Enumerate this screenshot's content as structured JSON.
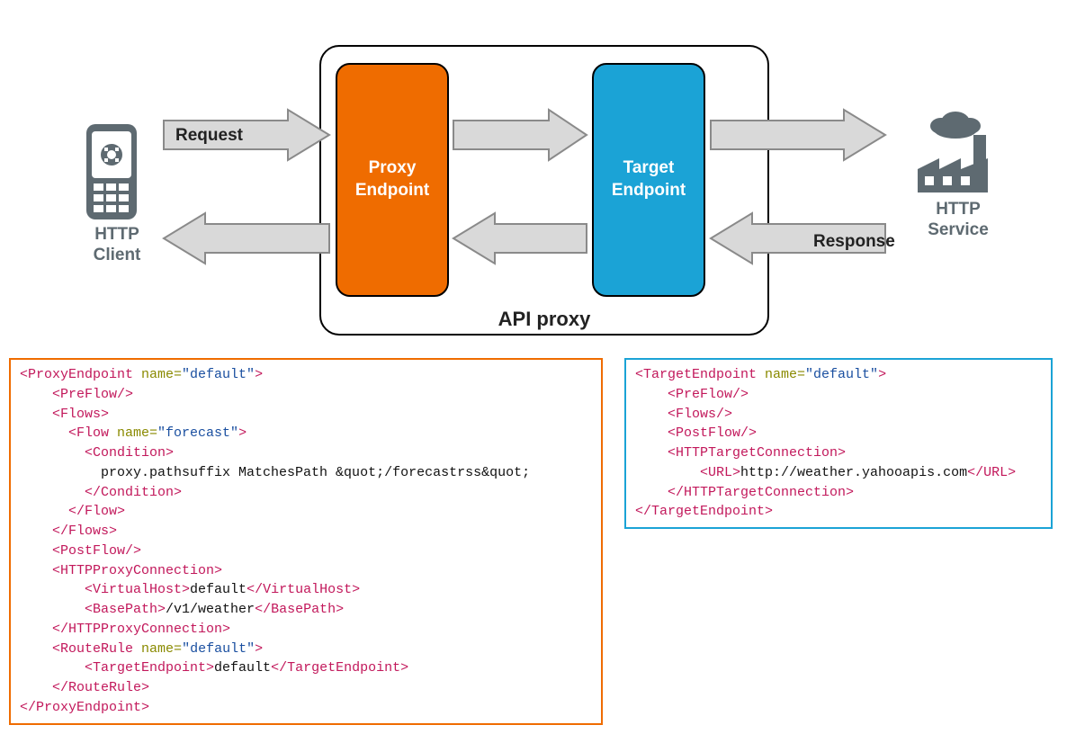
{
  "diagram": {
    "client_label_l1": "HTTP",
    "client_label_l2": "Client",
    "service_label_l1": "HTTP",
    "service_label_l2": "Service",
    "proxy_endpoint_l1": "Proxy",
    "proxy_endpoint_l2": "Endpoint",
    "target_endpoint_l1": "Target",
    "target_endpoint_l2": "Endpoint",
    "api_proxy_label": "API proxy",
    "request_label": "Request",
    "response_label": "Response"
  },
  "proxy_xml": {
    "root_open": "<ProxyEndpoint ",
    "root_attr": "name=",
    "root_val": "\"default\"",
    "root_close": ">",
    "preflow": "<PreFlow/>",
    "flows_open": "<Flows>",
    "flow_open": "<Flow ",
    "flow_attr": "name=",
    "flow_val": "\"forecast\"",
    "flow_close": ">",
    "cond_open": "<Condition>",
    "cond_text": "proxy.pathsuffix MatchesPath &quot;/forecastrss&quot;",
    "cond_close": "</Condition>",
    "flow_end": "</Flow>",
    "flows_close": "</Flows>",
    "postflow": "<PostFlow/>",
    "hpc_open": "<HTTPProxyConnection>",
    "vh_open": "<VirtualHost>",
    "vh_text": "default",
    "vh_close": "</VirtualHost>",
    "bp_open": "<BasePath>",
    "bp_text": "/v1/weather",
    "bp_close": "</BasePath>",
    "hpc_close": "</HTTPProxyConnection>",
    "rr_open": "<RouteRule ",
    "rr_attr": "name=",
    "rr_val": "\"default\"",
    "rr_close": ">",
    "te_open": "<TargetEndpoint>",
    "te_text": "default",
    "te_close": "</TargetEndpoint>",
    "rr_end": "</RouteRule>",
    "root_end": "</ProxyEndpoint>"
  },
  "target_xml": {
    "root_open": "<TargetEndpoint ",
    "root_attr": "name=",
    "root_val": "\"default\"",
    "root_close": ">",
    "preflow": "<PreFlow/>",
    "flows": "<Flows/>",
    "postflow": "<PostFlow/>",
    "htc_open": "<HTTPTargetConnection>",
    "url_open": "<URL>",
    "url_text": "http://weather.yahooapis.com",
    "url_close": "</URL>",
    "htc_close": "</HTTPTargetConnection>",
    "root_end": "</TargetEndpoint>"
  }
}
